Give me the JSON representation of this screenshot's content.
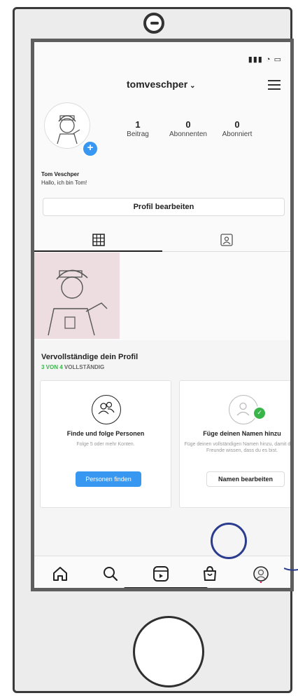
{
  "header": {
    "username": "tomveschper",
    "chevron": "⌄",
    "menu_icon": "hamburger-menu-icon"
  },
  "stats": [
    {
      "count": "1",
      "label": "Beitrag"
    },
    {
      "count": "0",
      "label": "Abonnenten"
    },
    {
      "count": "0",
      "label": "Abonniert"
    }
  ],
  "profile": {
    "name": "Tom Veschper",
    "bio": "Hallo, ich bin Tom!",
    "edit_label": "Profil bearbeiten"
  },
  "tabs": [
    {
      "icon": "grid-icon"
    },
    {
      "icon": "tagged-icon"
    }
  ],
  "completion": {
    "title": "Vervollständige dein Profil",
    "progress_highlight": "3 VON 4",
    "progress_rest": " VOLLSTÄNDIG",
    "cards": [
      {
        "title": "Finde und folge Personen",
        "desc": "Folge 5 oder mehr Konten.",
        "button": "Personen finden"
      },
      {
        "title": "Füge deinen Namen hinzu",
        "desc": "Füge deinen vollständigen Namen hinzu, damit deine Freunde wissen, dass du es bist.",
        "button": "Namen bearbeiten"
      }
    ]
  },
  "nav": [
    "home-icon",
    "search-icon",
    "reels-icon",
    "shop-icon",
    "profile-icon"
  ],
  "colors": {
    "accent": "#3897f0",
    "success": "#3ab54a",
    "highlight_ring": "#2b3c8e"
  }
}
